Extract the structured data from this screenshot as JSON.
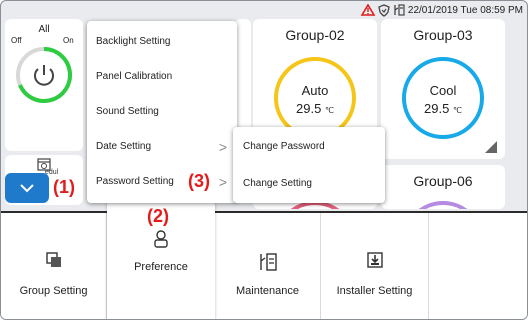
{
  "status_bar": {
    "datetime": "22/01/2019 Tue 08:59 PM",
    "icons": [
      "warning-triangle-icon",
      "shield-icon",
      "maintenance-icon"
    ],
    "warning_color": "#e31b1b"
  },
  "control": {
    "all_label": "All",
    "off_label": "Off",
    "on_label": "On",
    "power_ring_color": "#2ecc40"
  },
  "schedule": {
    "label": "edul"
  },
  "groups": [
    {
      "name": "Group-02",
      "mode": "Auto",
      "temp": "29.5",
      "unit": "℃",
      "ring_color": "#f5c518"
    },
    {
      "name": "Group-03",
      "mode": "Cool",
      "temp": "29.5",
      "unit": "℃",
      "ring_color": "#17a9e8"
    },
    {
      "name": "Group-06"
    }
  ],
  "menu": {
    "items": [
      {
        "label": "Backlight Setting"
      },
      {
        "label": "Panel Calibration"
      },
      {
        "label": "Sound Setting"
      },
      {
        "label": "Date Setting",
        "arrow": ">"
      },
      {
        "label": "Password Setting",
        "arrow": ">"
      }
    ]
  },
  "submenu": {
    "items": [
      {
        "label": "Change Password"
      },
      {
        "label": "Change Setting"
      }
    ]
  },
  "nav": {
    "items": [
      {
        "label": "Group Setting",
        "icon": "group-setting-icon"
      },
      {
        "label": "Preference",
        "icon": "preference-icon"
      },
      {
        "label": "Maintenance",
        "icon": "maintenance-icon"
      },
      {
        "label": "Installer Setting",
        "icon": "installer-setting-icon"
      }
    ]
  },
  "callouts": {
    "c1": "(1)",
    "c2": "(2)",
    "c3": "(3)"
  }
}
